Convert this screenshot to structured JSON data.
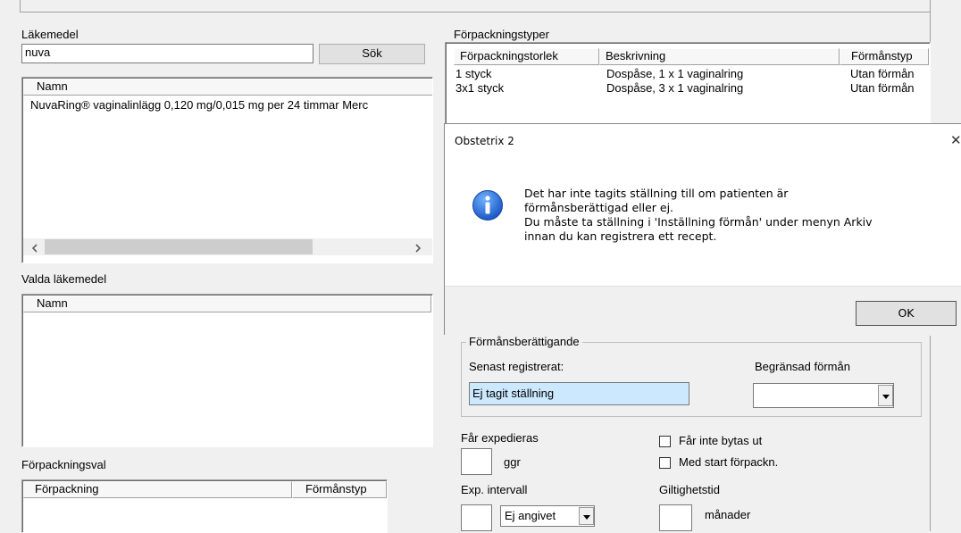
{
  "left": {
    "lakemedel_label": "Läkemedel",
    "search_value": "nuva",
    "search_button": "Sök",
    "drug_list": {
      "column": "Namn",
      "rows": [
        "NuvaRing® vaginalinlägg 0,120 mg/0,015 mg per 24 timmar Merc"
      ]
    },
    "valda_label": "Valda läkemedel",
    "valda_column": "Namn",
    "forpackningsval_label": "Förpackningsval",
    "forpackningsval_columns": [
      "Förpackning",
      "Förmånstyp"
    ]
  },
  "right": {
    "forpackningstyper_label": "Förpackningstyper",
    "columns": [
      "Förpackningstorlek",
      "Beskrivning",
      "Förmånstyp"
    ],
    "rows": [
      {
        "size": "1 styck",
        "desc": "Dospåse, 1 x 1 vaginalring",
        "type": "Utan förmån"
      },
      {
        "size": "3x1 styck",
        "desc": "Dospåse, 3 x 1 vaginalring",
        "type": "Utan förmån"
      }
    ],
    "formans_group": "Förmånsberättigande",
    "senast_label": "Senast registrerat:",
    "senast_value": "Ej tagit ställning",
    "begransad_label": "Begränsad förmån",
    "begransad_value": "",
    "far_expedieras_label": "Får expedieras",
    "far_expedieras_value": "",
    "ggr_label": "ggr",
    "far_inte_bytas_label": "Får inte bytas ut",
    "med_start_label": "Med start förpackn.",
    "exp_intervall_label": "Exp. intervall",
    "exp_intervall_num": "",
    "exp_intervall_unit": "Ej angivet",
    "giltighetstid_label": "Giltighetstid",
    "giltighetstid_value": "",
    "manader_label": "månader"
  },
  "dialog": {
    "title": "Obstetrix 2",
    "close_glyph": "✕",
    "message_lines": [
      "Det har inte tagits ställning till om patienten är",
      "förmånsberättigad eller ej.",
      "Du måste ta ställning i 'Inställning förmån' under menyn Arkiv",
      "innan du kan registrera ett recept."
    ],
    "ok_label": "OK",
    "icon": "info-icon"
  }
}
